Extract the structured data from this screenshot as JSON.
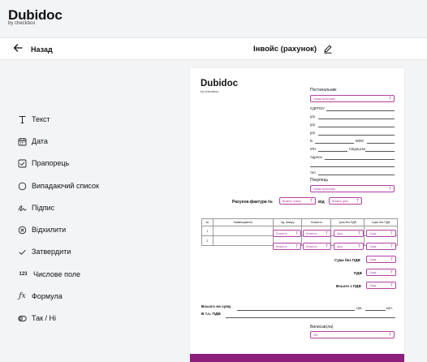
{
  "brand": {
    "name": "Dubidoc",
    "tagline": "by checkbox"
  },
  "toolbar": {
    "back_label": "Назад",
    "doc_title": "Інвойс (рахунок)"
  },
  "tools": [
    {
      "label": "Текст",
      "icon": "text-icon"
    },
    {
      "label": "Дата",
      "icon": "calendar-icon"
    },
    {
      "label": "Прапорець",
      "icon": "checkbox-icon"
    },
    {
      "label": "Випадаючий список",
      "icon": "dropdown-icon"
    },
    {
      "label": "Підпис",
      "icon": "signature-icon"
    },
    {
      "label": "Відхилити",
      "icon": "reject-icon"
    },
    {
      "label": "Затвердити",
      "icon": "check-icon"
    },
    {
      "label": "Числове поле",
      "icon": "number-icon"
    },
    {
      "label": "Формула",
      "icon": "formula-icon"
    },
    {
      "label": "Так / Ні",
      "icon": "yes-no-icon"
    }
  ],
  "document": {
    "logo": "Dubidoc",
    "logo_sub": "by checkbox",
    "supplier_label": "Постачальник",
    "supplier_ph": "Назва організації",
    "edrpou": "ЄДРПОУ",
    "rr1": "р/р",
    "rr2": "р/р",
    "rr3": "р/р",
    "v": "В",
    "mfo": "МФО",
    "ipn": "ІПН",
    "svid": "Свідоцтво",
    "address": "Адреса",
    "tel": "тел.",
    "buyer_label": "Покупець",
    "buyer_ph": "Назва організації",
    "invoice_label": "Рахунок-фактура №",
    "invoice_num_ph": "Вкажіть номер",
    "date_from": "від",
    "date_ph": "Вкажіть дату",
    "table_headers": [
      "№",
      "Найменування",
      "Од. виміру",
      "Кількість",
      "Ціна без ПДВ",
      "Сума без ПДВ"
    ],
    "rows": [
      {
        "num": "1",
        "qty_ph": "Кількість",
        "qty2_ph": "Кількість",
        "price_ph": "Ціна",
        "sum_ph": "Сума"
      },
      {
        "num": "2",
        "qty_ph": "Кількість",
        "qty2_ph": "Кількість",
        "price_ph": "Ціна",
        "sum_ph": "Сума"
      }
    ],
    "sum_no_vat": "Сума без ПДВ",
    "vat": "ПДВ",
    "total_vat": "Всього з ПДВ",
    "sum_ph": "Сума",
    "total_words": "Всього на суму",
    "grn": "грн.",
    "kop": "коп.",
    "incl_vat": "В т.ч. ПДВ",
    "issued_by": "Виписав(ла)",
    "pib_ph": "ПІБ"
  }
}
